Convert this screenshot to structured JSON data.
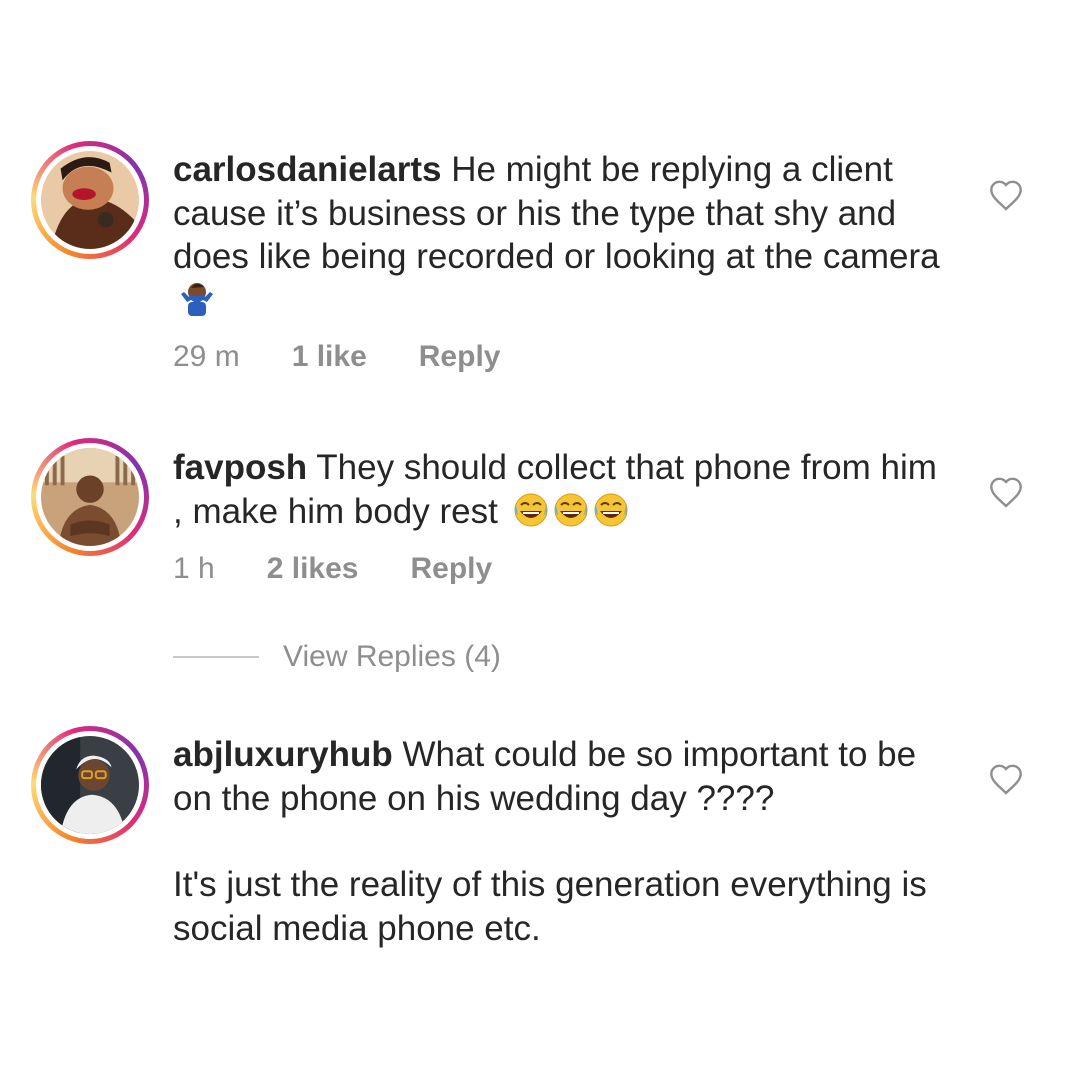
{
  "comments": [
    {
      "username": "carlosdanielarts",
      "text": "He might be replying a client cause it’s business or his the type that shy and does like being recorded or looking at the camera",
      "emoji": "person-shrugging",
      "time": "29 m",
      "likes": "1 like",
      "reply": "Reply"
    },
    {
      "username": "favposh",
      "text": "They should collect that phone from him , make him body rest",
      "emoji": "face-with-tears-of-joy x3",
      "time": "1 h",
      "likes": "2 likes",
      "reply": "Reply",
      "view_replies": "View Replies (4)"
    },
    {
      "username": "abjluxuryhub",
      "text": "What could be so important to be on the phone on his wedding day ????",
      "text2": "It's just the reality of this generation everything is social media phone etc."
    }
  ],
  "colors": {
    "text": "#262626",
    "meta": "#8e8e8e",
    "story_ring_start": "#f58529",
    "story_ring_end": "#8134af"
  },
  "icons": [
    "heart-outline-icon",
    "avatar"
  ]
}
